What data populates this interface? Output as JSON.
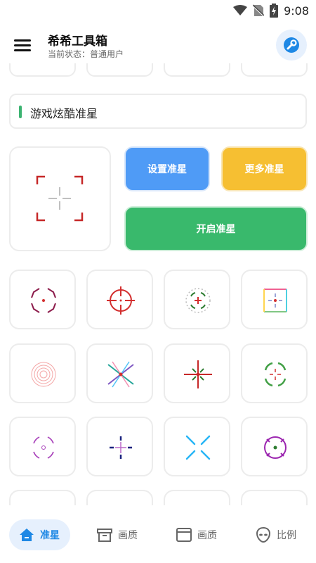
{
  "status_bar": {
    "time": "9:08"
  },
  "app": {
    "title": "希希工具箱",
    "subtitle": "当前状态：普通用户"
  },
  "section": {
    "title": "游戏炫酷准星"
  },
  "actions": {
    "set": "设置准星",
    "more": "更多准星",
    "open": "开启准星"
  },
  "bottom_nav": [
    {
      "label": "准星",
      "icon": "home-icon",
      "active": true
    },
    {
      "label": "画质",
      "icon": "archive-box-icon",
      "active": false
    },
    {
      "label": "画质",
      "icon": "window-icon",
      "active": false
    },
    {
      "label": "比例",
      "icon": "alien-face-icon",
      "active": false
    }
  ],
  "crosshairs": [
    {
      "icon": "crosshair-octagon-icon",
      "color": "#8b1a4a"
    },
    {
      "icon": "crosshair-scope-icon",
      "color": "#d32f2f"
    },
    {
      "icon": "crosshair-dotted-ring-icon",
      "color": "#2e7d32"
    },
    {
      "icon": "crosshair-rainbow-square-icon",
      "color": "#f06292"
    },
    {
      "icon": "crosshair-concentric-icon",
      "color": "#f4a7a7"
    },
    {
      "icon": "crosshair-x-multicolor-icon",
      "color": "#26a69a"
    },
    {
      "icon": "crosshair-star-icon",
      "color": "#c62828"
    },
    {
      "icon": "crosshair-green-brackets-icon",
      "color": "#43a047"
    },
    {
      "icon": "crosshair-purple-ring-icon",
      "color": "#ab47bc"
    },
    {
      "icon": "crosshair-navy-plus-icon",
      "color": "#1a237e"
    },
    {
      "icon": "crosshair-cyan-x-icon",
      "color": "#29b6f6"
    },
    {
      "icon": "crosshair-magenta-circle-icon",
      "color": "#9c27b0"
    }
  ],
  "colors": {
    "accent": "#1e88e5",
    "set_button": "#4f9bf6",
    "more_button": "#f6bf32",
    "open_button": "#39b96c"
  }
}
